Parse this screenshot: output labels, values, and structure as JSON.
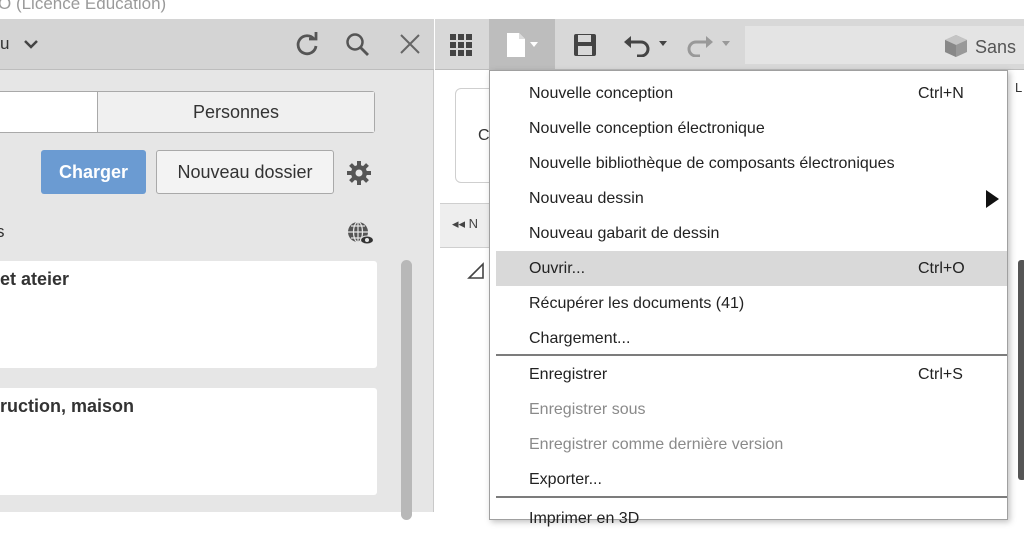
{
  "app": {
    "title": "O (Licence Education)"
  },
  "left_panel": {
    "toolbar": {
      "label": "u",
      "icons": [
        "refresh-icon",
        "search-icon",
        "close-icon"
      ]
    },
    "tabs": [
      {
        "label": ""
      },
      {
        "label": "Personnes"
      }
    ],
    "buttons": {
      "charger": "Charger",
      "nouveau_dossier": "Nouveau dossier"
    },
    "section_label": "s",
    "cards": [
      {
        "title": "et ateier"
      },
      {
        "title": "ruction, maison"
      }
    ]
  },
  "right_toolbar": {
    "search_label": "Sans",
    "icons": [
      "grid-icon",
      "file-icon",
      "save-icon",
      "undo-icon",
      "redo-icon",
      "cube-icon"
    ]
  },
  "right_content": {
    "panel_letter": "C",
    "bar_label": "◂◂  N",
    "top_label": "L"
  },
  "file_menu": {
    "items": [
      {
        "label": "Nouvelle conception",
        "shortcut": "Ctrl+N"
      },
      {
        "label": "Nouvelle conception électronique",
        "shortcut": ""
      },
      {
        "label": "Nouvelle bibliothèque de composants électroniques",
        "shortcut": ""
      },
      {
        "label": "Nouveau dessin",
        "shortcut": "",
        "submenu": true
      },
      {
        "label": "Nouveau gabarit de dessin",
        "shortcut": ""
      },
      {
        "label": "Ouvrir...",
        "shortcut": "Ctrl+O",
        "highlighted": true
      },
      {
        "label": "Récupérer les documents (41)",
        "shortcut": ""
      },
      {
        "label": "Chargement...",
        "shortcut": ""
      },
      {
        "label": "Enregistrer",
        "shortcut": "Ctrl+S"
      },
      {
        "label": "Enregistrer sous",
        "shortcut": "",
        "disabled": true
      },
      {
        "label": "Enregistrer comme dernière version",
        "shortcut": "",
        "disabled": true
      },
      {
        "label": "Exporter...",
        "shortcut": ""
      },
      {
        "label": "Imprimer en 3D",
        "shortcut": ""
      }
    ]
  },
  "colors": {
    "accent": "#6b9bd2",
    "menu_highlight": "#d9d9d9",
    "disabled_text": "#8a8a8a"
  }
}
